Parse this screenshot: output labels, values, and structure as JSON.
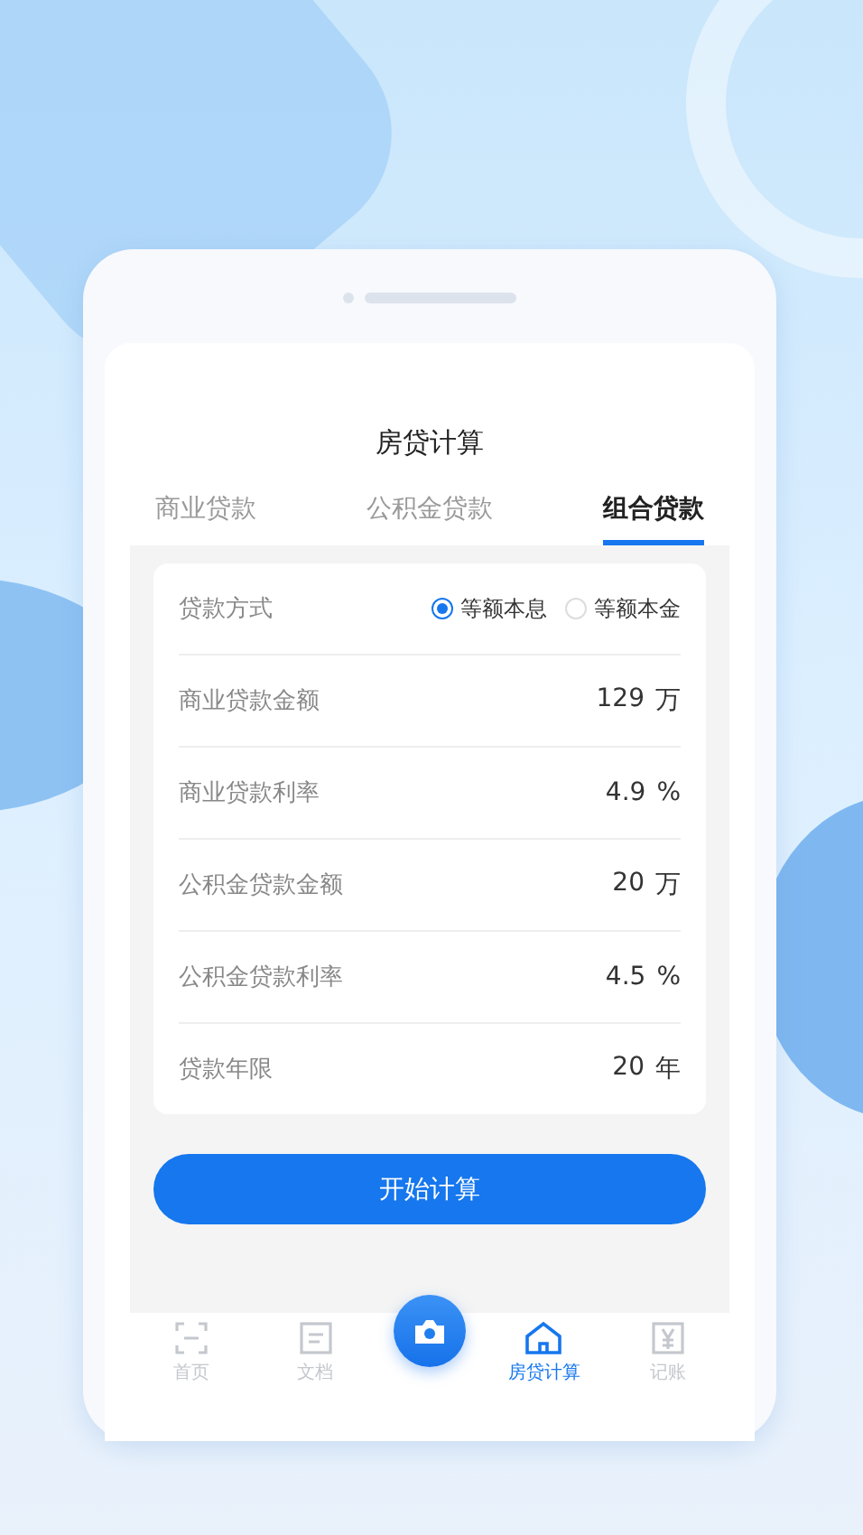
{
  "screen": {
    "title": "房贷计算"
  },
  "tabs": [
    {
      "label": "商业贷款",
      "selected": false
    },
    {
      "label": "公积金贷款",
      "selected": false
    },
    {
      "label": "组合贷款",
      "selected": true
    }
  ],
  "method": {
    "label": "贷款方式",
    "options": [
      {
        "label": "等额本息",
        "selected": true
      },
      {
        "label": "等额本金",
        "selected": false
      }
    ]
  },
  "fields": [
    {
      "label": "商业贷款金额",
      "value": "129",
      "unit": "万"
    },
    {
      "label": "商业贷款利率",
      "value": "4.9",
      "unit": "%"
    },
    {
      "label": "公积金贷款金额",
      "value": "20",
      "unit": "万"
    },
    {
      "label": "公积金贷款利率",
      "value": "4.5",
      "unit": "%"
    },
    {
      "label": "贷款年限",
      "value": "20",
      "unit": "年"
    }
  ],
  "calculate_button": "开始计算",
  "nav": [
    {
      "label": "首页",
      "selected": false
    },
    {
      "label": "文档",
      "selected": false
    },
    {
      "label": "房贷计算",
      "selected": true
    },
    {
      "label": "记账",
      "selected": false
    }
  ]
}
